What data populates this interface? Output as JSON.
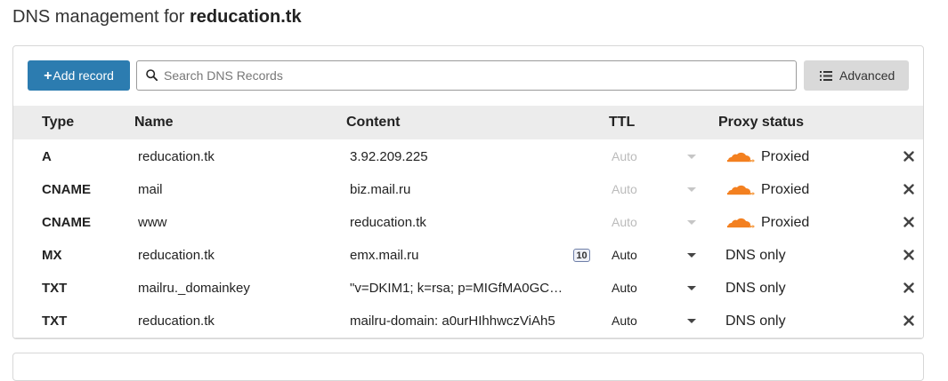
{
  "header": {
    "title_prefix": "DNS management for",
    "domain": "reducation.tk"
  },
  "toolbar": {
    "add_plus": "+",
    "add_label": "Add record",
    "search_placeholder": "Search DNS Records",
    "advanced_label": "Advanced"
  },
  "table": {
    "headers": {
      "type": "Type",
      "name": "Name",
      "content": "Content",
      "ttl": "TTL",
      "proxy": "Proxy status"
    },
    "rows": [
      {
        "type": "A",
        "name": "reducation.tk",
        "content": "3.92.209.225",
        "priority": "",
        "ttl": "Auto",
        "ttl_enabled": false,
        "proxy": "Proxied",
        "proxied": true
      },
      {
        "type": "CNAME",
        "name": "mail",
        "content": "biz.mail.ru",
        "priority": "",
        "ttl": "Auto",
        "ttl_enabled": false,
        "proxy": "Proxied",
        "proxied": true
      },
      {
        "type": "CNAME",
        "name": "www",
        "content": "reducation.tk",
        "priority": "",
        "ttl": "Auto",
        "ttl_enabled": false,
        "proxy": "Proxied",
        "proxied": true
      },
      {
        "type": "MX",
        "name": "reducation.tk",
        "content": "emx.mail.ru",
        "priority": "10",
        "ttl": "Auto",
        "ttl_enabled": true,
        "proxy": "DNS only",
        "proxied": false
      },
      {
        "type": "TXT",
        "name": "mailru._domainkey",
        "content": "\"v=DKIM1; k=rsa; p=MIGfMA0GC…",
        "priority": "",
        "ttl": "Auto",
        "ttl_enabled": true,
        "proxy": "DNS only",
        "proxied": false
      },
      {
        "type": "TXT",
        "name": "reducation.tk",
        "content": "mailru-domain: a0urHIhhwczViAh5",
        "priority": "",
        "ttl": "Auto",
        "ttl_enabled": true,
        "proxy": "DNS only",
        "proxied": false
      }
    ]
  },
  "icons": {
    "search": "search-icon",
    "advanced": "list-icon",
    "proxied": "cloud-icon",
    "delete": "close-icon"
  },
  "colors": {
    "primary": "#2c7cb0",
    "cloud": "#f38020",
    "header_bg": "#ececec"
  }
}
